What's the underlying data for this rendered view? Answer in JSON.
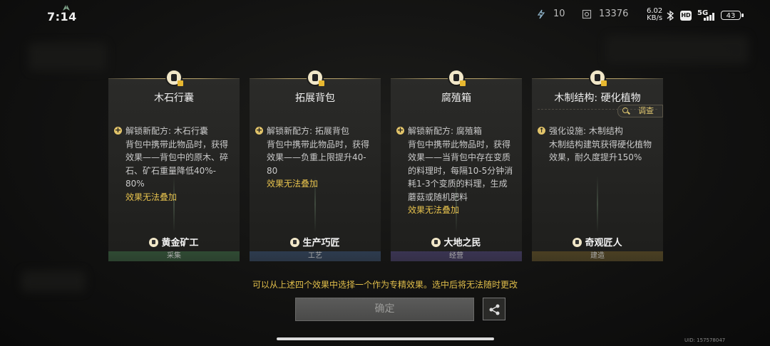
{
  "status_bar": {
    "time": "7:14",
    "resource_1": "10",
    "resource_2": "13376",
    "net_speed": "6.02",
    "net_unit": "KB/s",
    "hd_label": "HD",
    "signal_label": "5G",
    "battery": "43"
  },
  "cards": [
    {
      "title": "木石行囊",
      "unlock_line": "解锁新配方: 木石行囊",
      "desc_lines": [
        "背包中携带此物品时，获得",
        "效果——背包中的原木、碎",
        "石、矿石重量降低40%-",
        "80%"
      ],
      "warning": "效果无法叠加",
      "role": "黄金矿工",
      "category": "采集",
      "strip_color": "#2f4a33"
    },
    {
      "title": "拓展背包",
      "unlock_line": "解锁新配方: 拓展背包",
      "desc_lines": [
        "背包中携带此物品时，获得",
        "效果——负重上限提升40-",
        "80"
      ],
      "warning": "效果无法叠加",
      "role": "生产巧匠",
      "category": "工艺",
      "strip_color": "#2d3b4e"
    },
    {
      "title": "腐殖箱",
      "unlock_line": "解锁新配方: 腐殖箱",
      "desc_lines": [
        "背包中携带此物品时，获得",
        "效果——当背包中存在变质",
        "的料理时，每隔10-5分钟消",
        "耗1-3个变质的料理，生成",
        "蘑菇或随机肥料"
      ],
      "warning": "效果无法叠加",
      "role": "大地之民",
      "category": "经营",
      "strip_color": "#3a3452"
    },
    {
      "title": "木制结构: 硬化植物",
      "unlock_line": "强化设施: 木制结构",
      "desc_lines": [
        "木制结构建筑获得硬化植物",
        "效果，耐久度提升150%"
      ],
      "warning": "",
      "role": "奇观匠人",
      "category": "建造",
      "strip_color": "#4a3f22",
      "inspect_label": "调查"
    }
  ],
  "hint": "可以从上述四个效果中选择一个作为专精效果。选中后将无法随时更改",
  "confirm_label": "确定",
  "uid": "UID: 157578047",
  "colors": {
    "accent_gold": "#e5c14d",
    "confirm_disabled": "#4a4a49"
  }
}
